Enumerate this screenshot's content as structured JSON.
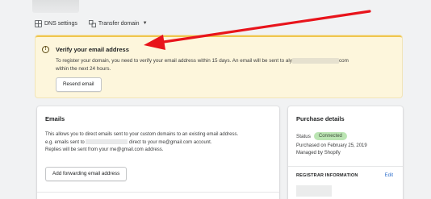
{
  "toolbar": {
    "dns_label": "DNS settings",
    "transfer_label": "Transfer domain"
  },
  "banner": {
    "title": "Verify your email address",
    "body_prefix": "To register your domain, you need to verify your email address within 15 days. An email will be sent to",
    "email_start": "aly",
    "email_end": "com",
    "body_suffix": "within the next 24 hours.",
    "resend_label": "Resend email",
    "accent_color": "#f0c64e",
    "background_color": "#fdf6dc"
  },
  "emails": {
    "title": "Emails",
    "line1": "This allows you to direct emails sent to your custom domains to an existing email address.",
    "line2_prefix": "e.g. emails sent to",
    "line2_suffix": "direct to your me@gmail.com account.",
    "line3": "Replies will be sent from your me@gmail.com address.",
    "add_label": "Add forwarding email address"
  },
  "purchase": {
    "title": "Purchase details",
    "status_label": "Status",
    "status_value": "Connected",
    "status_color": "#bbe5b3",
    "purchased_on": "Purchased on February 25, 2019",
    "managed_by": "Managed by Shopify",
    "registrar_title": "REGISTRAR INFORMATION",
    "edit_label": "Edit"
  },
  "annotation": {
    "arrow_color": "#e8141b"
  }
}
